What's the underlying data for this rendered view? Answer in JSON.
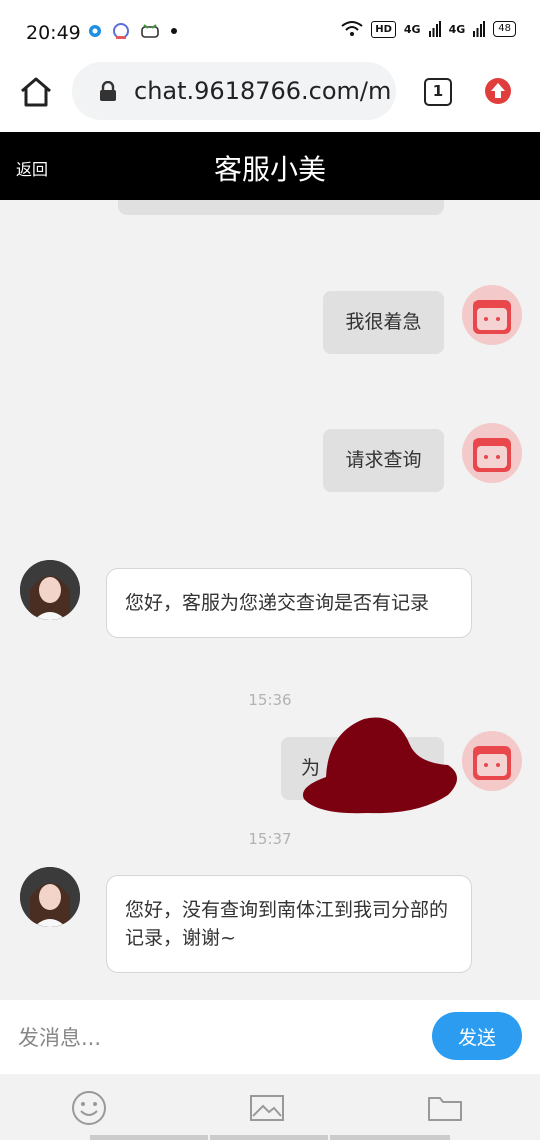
{
  "status_bar": {
    "time": "20:49",
    "net1": "HD",
    "net2": "4G",
    "net3": "4G",
    "battery": "48"
  },
  "browser": {
    "url": "chat.9618766.com/m",
    "tab_count": "1"
  },
  "header": {
    "back_label": "返回",
    "title": "客服小美"
  },
  "messages": {
    "m1": "我很着急",
    "m2": "请求查询",
    "m3": "您好，客服为您递交查询是否有记录",
    "t1": "15:36",
    "m4": "为",
    "t2": "15:37",
    "m5": "您好，没有查询到南体江到我司分部的记录，谢谢~"
  },
  "input": {
    "placeholder": "发消息...",
    "send_label": "发送"
  },
  "colors": {
    "accent": "#2b9cf0",
    "header_bg": "#000000",
    "user_avatar": "#e8474c",
    "redaction": "#7b0010"
  },
  "toolbar_icons": [
    "smile-icon",
    "image-icon",
    "folder-icon"
  ]
}
